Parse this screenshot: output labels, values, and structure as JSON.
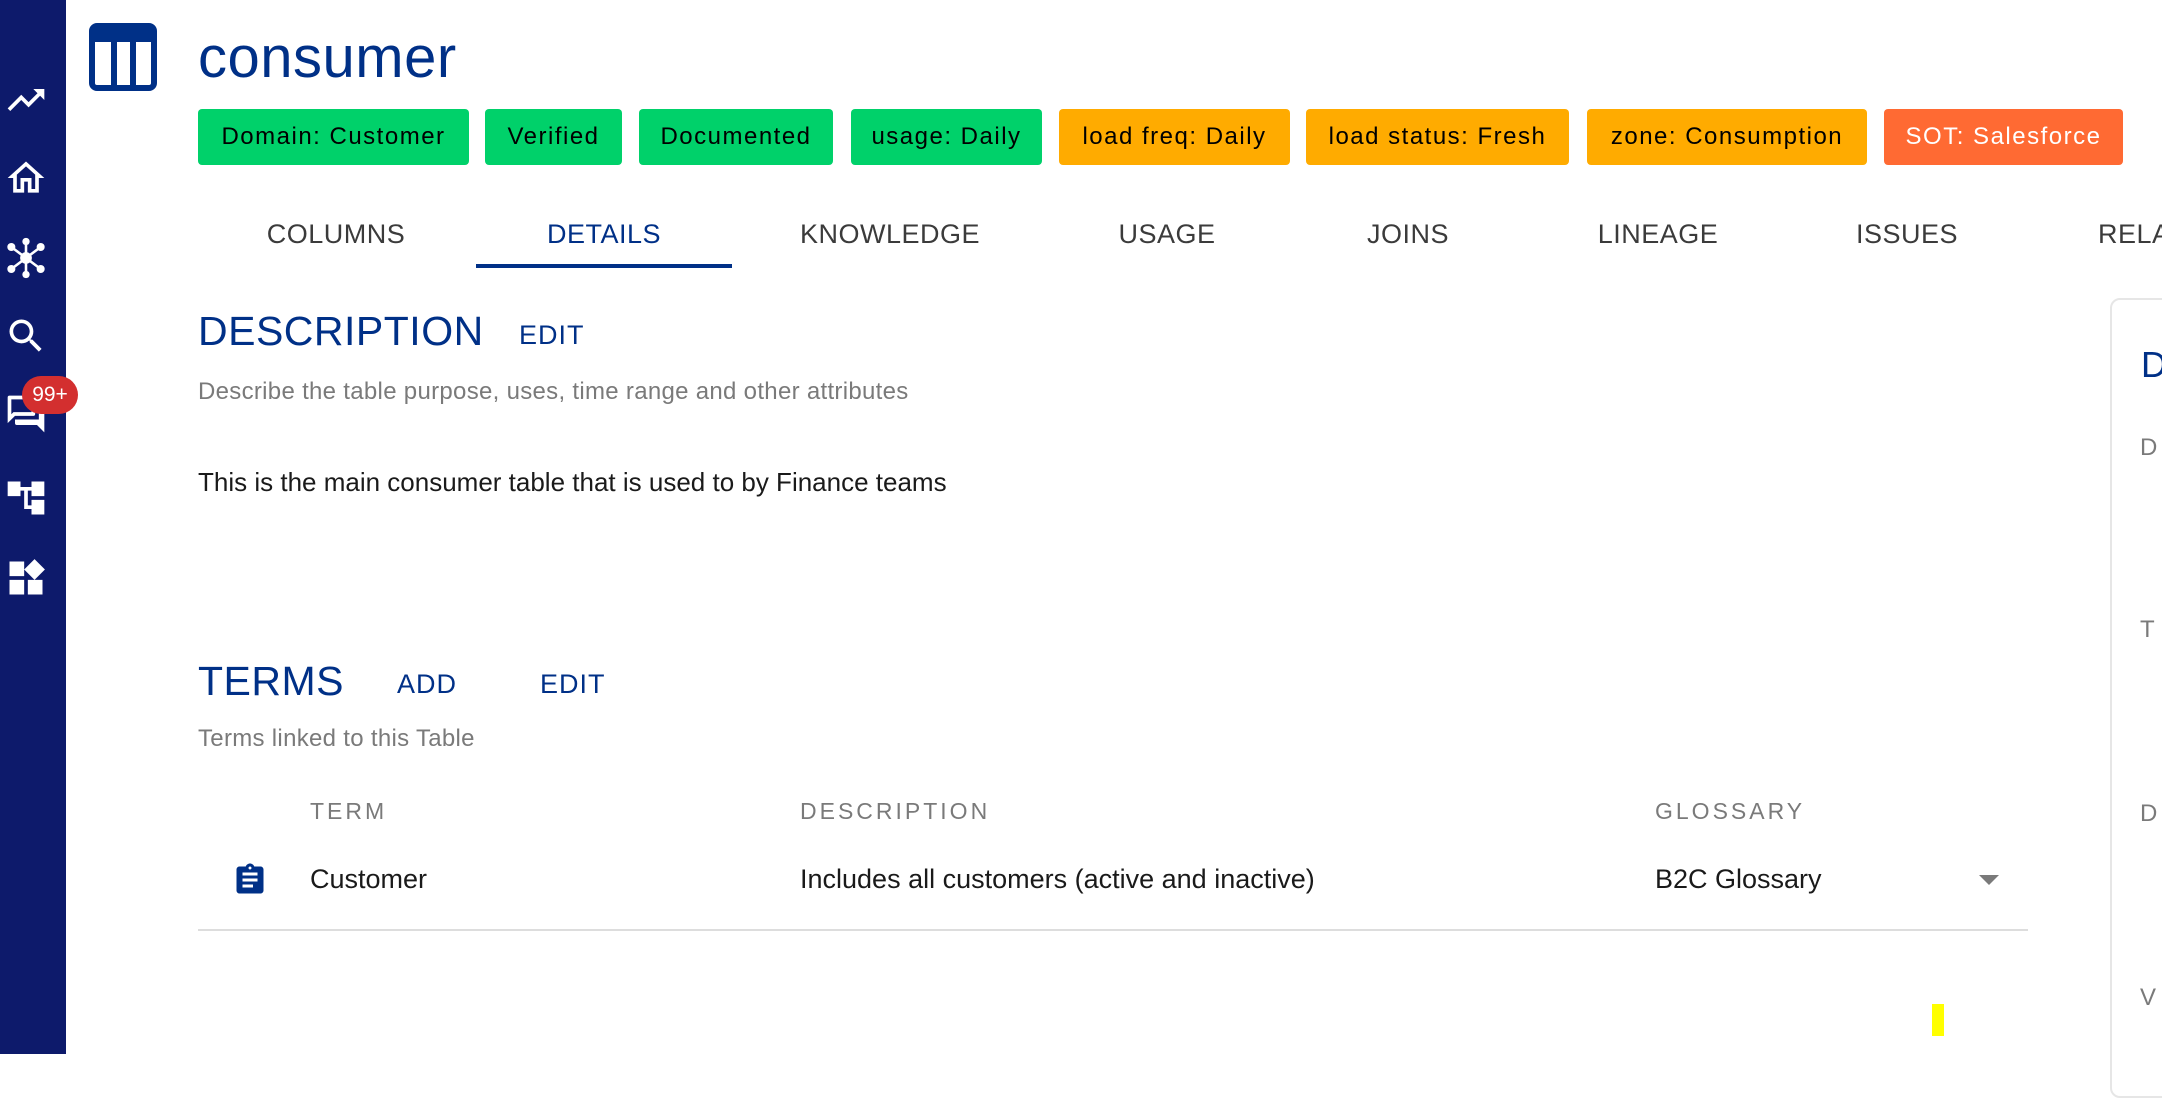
{
  "sidebar": {
    "items": [
      {
        "icon": "trending-up-icon"
      },
      {
        "icon": "home-icon"
      },
      {
        "icon": "network-icon"
      },
      {
        "icon": "search-icon"
      },
      {
        "icon": "chat-icon"
      },
      {
        "icon": "hierarchy-icon"
      },
      {
        "icon": "dashboard-icon"
      }
    ],
    "notification_badge": "99+"
  },
  "header": {
    "icon": "table-icon",
    "title": "consumer",
    "tags": [
      {
        "label": "Domain: Customer",
        "color": "#00d16a"
      },
      {
        "label": "Verified",
        "color": "#00d16a"
      },
      {
        "label": "Documented",
        "color": "#00d16a"
      },
      {
        "label": "usage: Daily",
        "color": "#00d16a"
      },
      {
        "label": "load freq: Daily",
        "color": "#ffab00"
      },
      {
        "label": "load status: Fresh",
        "color": "#ffab00"
      },
      {
        "label": "zone: Consumption",
        "color": "#ffab00"
      },
      {
        "label": "SOT: Salesforce",
        "color": "#ff6a33"
      }
    ]
  },
  "tabs": [
    {
      "label": "COLUMNS"
    },
    {
      "label": "DETAILS",
      "active": true
    },
    {
      "label": "KNOWLEDGE"
    },
    {
      "label": "USAGE"
    },
    {
      "label": "JOINS"
    },
    {
      "label": "LINEAGE"
    },
    {
      "label": "ISSUES"
    },
    {
      "label": "RELA"
    }
  ],
  "description": {
    "title": "DESCRIPTION",
    "edit_label": "EDIT",
    "subtitle": "Describe the table purpose, uses, time range and other attributes",
    "text": "This is the main consumer table that is used to by Finance teams"
  },
  "terms": {
    "title": "TERMS",
    "add_label": "ADD",
    "edit_label": "EDIT",
    "subtitle": "Terms linked to this Table",
    "columns": [
      "TERM",
      "DESCRIPTION",
      "GLOSSARY"
    ],
    "rows": [
      {
        "icon": "clipboard-icon",
        "term": "Customer",
        "description": "Includes all customers (active and inactive)",
        "glossary": "B2C Glossary"
      }
    ]
  },
  "side_panel": {
    "title": "D",
    "labels": [
      "D",
      "T",
      "D",
      "V"
    ]
  },
  "colors": {
    "sidebar": "#0d1a6b",
    "primary": "#003087",
    "badge": "#d32f2f"
  }
}
